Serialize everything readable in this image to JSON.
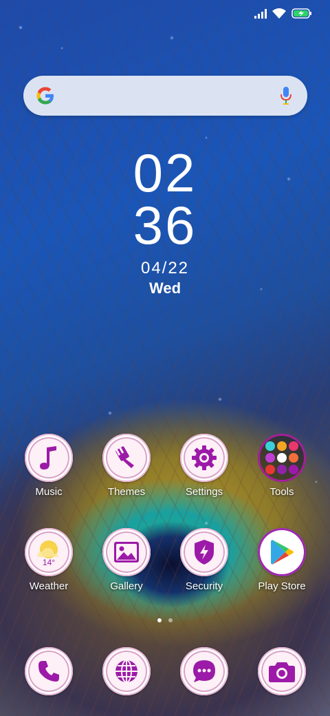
{
  "status_bar": {
    "icons": [
      "signal-icon",
      "wifi-icon",
      "battery-charging-icon"
    ]
  },
  "search": {
    "logo": "google-g-icon",
    "mic": "mic-icon"
  },
  "clock": {
    "hour": "02",
    "minute": "36",
    "date": "04/22",
    "day": "Wed"
  },
  "apps_row1": [
    {
      "label": "Music",
      "icon": "music-note-icon"
    },
    {
      "label": "Themes",
      "icon": "paint-brush-icon"
    },
    {
      "label": "Settings",
      "icon": "gear-icon"
    },
    {
      "label": "Tools",
      "icon": "folder-icon"
    }
  ],
  "apps_row2": [
    {
      "label": "Weather",
      "icon": "weather-sun-icon",
      "temp": "14°"
    },
    {
      "label": "Gallery",
      "icon": "image-icon"
    },
    {
      "label": "Security",
      "icon": "shield-bolt-icon"
    },
    {
      "label": "Play Store",
      "icon": "play-store-icon"
    }
  ],
  "dock": [
    {
      "icon": "phone-icon"
    },
    {
      "icon": "globe-icon"
    },
    {
      "icon": "chat-icon"
    },
    {
      "icon": "camera-icon"
    }
  ],
  "colors": {
    "icon_accent": "#9c1aa8",
    "icon_bg": "#fdf0f6"
  }
}
